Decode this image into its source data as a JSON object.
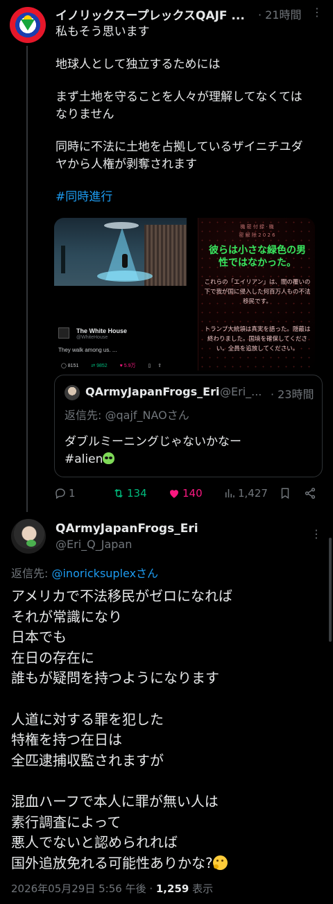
{
  "tweet1": {
    "name": "イノリックスープレックスQAJF ...",
    "time": "· 21時間",
    "more": "⋮",
    "lines": [
      "私もそう思います",
      "",
      "地球人として独立するためには",
      "",
      "まず土地を守ることを人々が理解してなくては",
      "なりません",
      "",
      "同時に不法に土地を占拠しているザイニチユダ",
      "ヤから人権が剥奪されます",
      ""
    ],
    "hashtag": "#同時進行",
    "media_left": {
      "account_name": "The White House",
      "account_handle": "@WhiteHouse",
      "text": "They walk among us. ...",
      "stats": [
        "8151",
        "9852",
        "5.9万"
      ]
    },
    "media_right": {
      "header1": "機 密 付 録 · 機",
      "header2": "密 解 除 2 0 2 6",
      "title": "彼らは小さな緑色の男性ではなかった。",
      "text1": "これらの「エイリアン」は、闇の覆いの下で我が国に侵入した何百万人もの不法移民です。",
      "text2": "トランプ大統領は真実を語った。隠蔽は終わりました。国境を確保してください。全員を追放してください。"
    },
    "quote": {
      "name": "QArmyJapanFrogs_Eri",
      "handle": "@Eri_...",
      "time": "· 23時間",
      "reply_to": "返信先: @qajf_NAOさん",
      "line1": "ダブルミーニングじゃないかなー",
      "line2": "#alien"
    },
    "actions": {
      "replies": "1",
      "retweets": "134",
      "likes": "140",
      "views": "1,427"
    }
  },
  "tweet2": {
    "name": "QArmyJapanFrogs_Eri",
    "handle": "@Eri_Q_Japan",
    "more": "⋮",
    "reply_prefix": "返信先: ",
    "reply_mention": "@inoricksuplexさん",
    "lines": [
      "アメリカで不法移民がゼロになれば",
      "それが常識になり",
      "日本でも",
      "在日の存在に",
      "誰もが疑問を持つようになります",
      "",
      "人道に対する罪を犯した",
      "特権を持つ在日は",
      "全匹逮捕収監されますが",
      "",
      "混血ハーフで本人に罪が無い人は",
      "素行調査によって",
      "悪人でないと認められれば",
      "国外追放免れる可能性ありかな?"
    ],
    "timestamp": "2026年05月29日 5:56 午後 · ",
    "view_count": "1,259",
    "view_label": " 表示"
  },
  "colors": {
    "accent": "#1d9bf0",
    "retweet": "#00ba7c",
    "like": "#f91880",
    "muted": "#71767b"
  }
}
